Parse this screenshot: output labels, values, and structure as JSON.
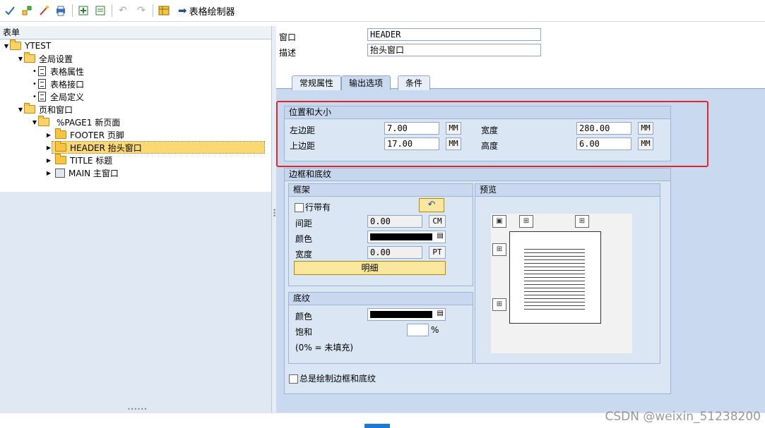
{
  "toolbar": {
    "icons": [
      "check-syntax-icon",
      "hierarchy-icon",
      "wand-icon",
      "print-icon",
      "create-icon",
      "form-icon",
      "undo-icon",
      "redo-icon",
      "table-painter-icon"
    ],
    "table_painter_label": "表格绘制器"
  },
  "tree": {
    "header": "表单",
    "root": "YTEST",
    "global_settings": "全局设置",
    "global_items": [
      "表格属性",
      "表格接口",
      "全局定义"
    ],
    "pages_and_windows": "页和窗口",
    "page": "%PAGE1 新页面",
    "windows": [
      "FOOTER 页脚",
      "HEADER 抬头窗口",
      "TITLE 标题",
      "MAIN 主窗口"
    ]
  },
  "form": {
    "window_label": "窗口",
    "window_value": "HEADER",
    "desc_label": "描述",
    "desc_value": "抬头窗口"
  },
  "tabs": [
    "常规属性",
    "输出选项",
    "条件"
  ],
  "active_tab": "输出选项",
  "position_size": {
    "title": "位置和大小",
    "left_margin_label": "左边距",
    "left_margin_value": "7.00",
    "left_margin_unit": "MM",
    "top_margin_label": "上边距",
    "top_margin_value": "17.00",
    "top_margin_unit": "MM",
    "width_label": "宽度",
    "width_value": "280.00",
    "width_unit": "MM",
    "height_label": "高度",
    "height_value": "6.00",
    "height_unit": "MM"
  },
  "border_shading": {
    "title": "边框和底纹",
    "frame": {
      "title": "框架",
      "row_label": "行带有",
      "spacing_label": "间距",
      "spacing_value": "0.00",
      "spacing_unit": "CM",
      "color_label": "颜色",
      "width_label": "宽度",
      "width_value": "0.00",
      "width_unit": "PT",
      "details_button": "明细"
    },
    "preview": {
      "title": "预览"
    },
    "shading": {
      "title": "底纹",
      "color_label": "颜色",
      "saturation_label": "饱和",
      "saturation_value": "",
      "saturation_unit": "%",
      "hint": "(0% = 未填充)"
    },
    "always_draw_label": "总是绘制边框和底纹"
  },
  "watermark": "CSDN @weixin_51238200",
  "colors": {
    "highlight": "#e0262b",
    "selection": "#fcd873",
    "panel": "#c9daf0"
  }
}
